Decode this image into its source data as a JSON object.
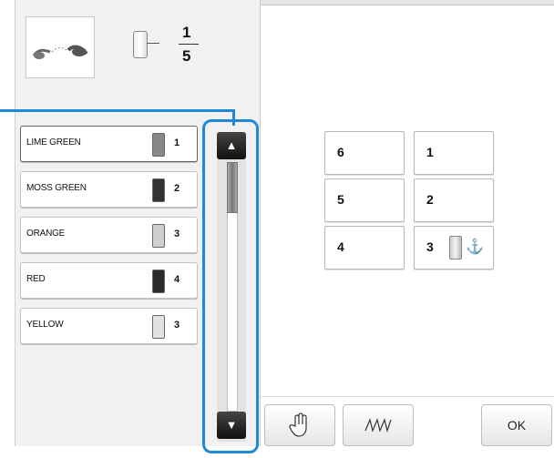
{
  "progress": {
    "current": "1",
    "total": "5"
  },
  "colors": [
    {
      "name": "LIME GREEN",
      "needle": "1",
      "swatch": "#888888",
      "selected": true
    },
    {
      "name": "MOSS GREEN",
      "needle": "2",
      "swatch": "#333333",
      "selected": false
    },
    {
      "name": "ORANGE",
      "needle": "3",
      "swatch": "#cfcfcf",
      "selected": false
    },
    {
      "name": "RED",
      "needle": "4",
      "swatch": "#2a2a2a",
      "selected": false
    },
    {
      "name": "YELLOW",
      "needle": "3",
      "swatch": "#e2e2e2",
      "selected": false
    }
  ],
  "scrollbar": {
    "up_icon": "triangle-up-icon",
    "down_icon": "triangle-down-icon",
    "up_glyph": "▲",
    "down_glyph": "▼",
    "highlight_color": "#1e8ad6"
  },
  "needles": [
    {
      "label": "6"
    },
    {
      "label": "1"
    },
    {
      "label": "5"
    },
    {
      "label": "2"
    },
    {
      "label": "4"
    },
    {
      "label": "3",
      "current": true,
      "icon": "anchor-icon",
      "glyph": "⚓"
    }
  ],
  "toolbar": {
    "hand_icon": "hand-icon",
    "stitch_icon": "stitch-icon",
    "ok_label": "OK"
  }
}
